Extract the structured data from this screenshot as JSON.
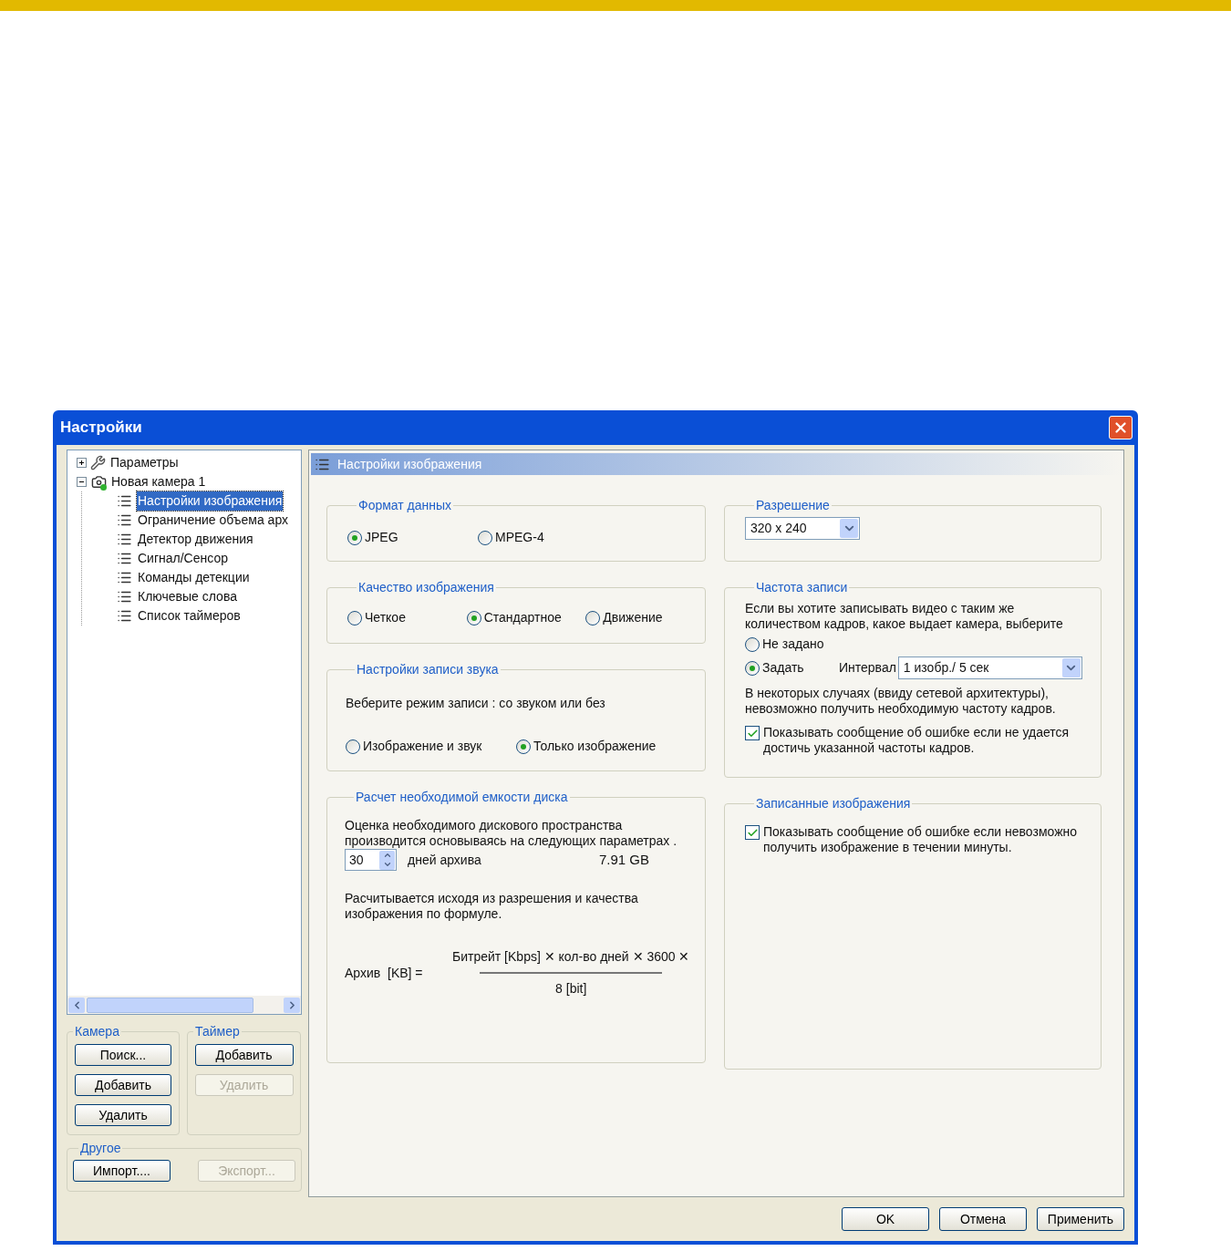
{
  "window": {
    "title": "Настройки"
  },
  "tree": [
    {
      "label": "Параметры",
      "kind": "wrench",
      "expanded": false,
      "selected": false
    },
    {
      "label": "Новая камера 1",
      "kind": "camera",
      "expanded": true,
      "selected": false,
      "children": [
        {
          "label": "Настройки изображения",
          "selected": true
        },
        {
          "label": "Ограничение объема арх",
          "selected": false
        },
        {
          "label": "Детектор движения",
          "selected": false
        },
        {
          "label": "Сигнал/Сенсор",
          "selected": false
        },
        {
          "label": "Команды детекции",
          "selected": false
        },
        {
          "label": "Ключевые слова",
          "selected": false
        },
        {
          "label": "Список таймеров",
          "selected": false
        }
      ]
    }
  ],
  "camera_group": {
    "title": "Камера",
    "buttons": [
      {
        "label": "Поиск...",
        "disabled": false
      },
      {
        "label": "Добавить",
        "disabled": false
      },
      {
        "label": "Удалить",
        "disabled": false
      }
    ]
  },
  "timer_group": {
    "title": "Таймер",
    "buttons": [
      {
        "label": "Добавить",
        "disabled": false
      },
      {
        "label": "Удалить",
        "disabled": true
      }
    ]
  },
  "other_group": {
    "title": "Другое",
    "buttons": [
      {
        "label": "Импорт....",
        "disabled": false
      },
      {
        "label": "Экспорт...",
        "disabled": true
      }
    ]
  },
  "panel": {
    "title": "Настройки изображения",
    "data_format": {
      "title": "Формат данных",
      "options": [
        {
          "label": "JPEG",
          "selected": true
        },
        {
          "label": "MPEG-4",
          "selected": false
        }
      ]
    },
    "resolution": {
      "title": "Разрешение",
      "value": "320 x 240"
    },
    "quality": {
      "title": "Качество изображения",
      "options": [
        {
          "label": "Четкое",
          "selected": false
        },
        {
          "label": "Стандартное",
          "selected": true
        },
        {
          "label": "Движение",
          "selected": false
        }
      ]
    },
    "audio": {
      "title": "Настройки записи звука",
      "prompt": "Веберите режим записи : со звуком или без",
      "options": [
        {
          "label": "Изображение и звук",
          "selected": false
        },
        {
          "label": "Только изображение",
          "selected": true
        }
      ]
    },
    "frame_rate": {
      "title": "Частота записи",
      "description": "Если вы хотите записывать видео с таким же количеством кадров, какое выдает камера, выберите",
      "options": [
        {
          "label": "Не задано",
          "selected": false
        },
        {
          "label": "Задать",
          "selected": true
        }
      ],
      "interval_label": "Интервал",
      "interval_value": "1 изобр./ 5 сек",
      "note": "В некоторых случаях (ввиду сетевой архитектуры), невозможно получить необходимую частоту кадров.",
      "checkbox": {
        "label": "Показывать сообщение об ошибке если не удается достичь указанной частоты кадров.",
        "checked": true
      }
    },
    "disk": {
      "title": "Расчет необходимой емкости диска",
      "description": "Оценка необходимого дискового пространства производится основываясь на следующих параметрах .",
      "days": "30",
      "days_label": "дней архива",
      "size": "7.91 GB",
      "formula_note": "Расчитывается исходя из разрешения и качества изображения по формуле.",
      "formula_label": "Архив  [KB] =",
      "numerator": "Битрейт [Kbps] ✕ кол-во дней ✕ 3600 ✕",
      "denominator": "8 [bit]"
    },
    "recorded": {
      "title": "Записанные изображения",
      "checkbox": {
        "label": "Показывать сообщение об ошибке если невозможно получить изображение в течении минуты.",
        "checked": true
      }
    }
  },
  "buttons": [
    {
      "label": "OK",
      "disabled": false
    },
    {
      "label": "Отмена",
      "disabled": false
    },
    {
      "label": "Применить",
      "disabled": false
    }
  ]
}
